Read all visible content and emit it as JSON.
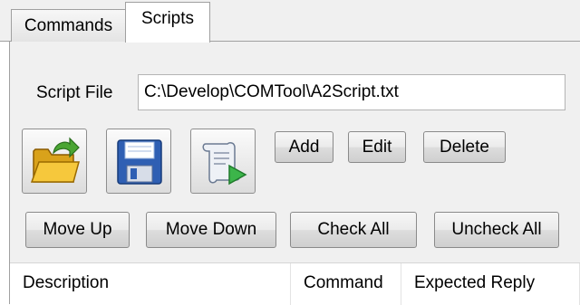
{
  "tabs": [
    {
      "label": "Commands"
    },
    {
      "label": "Scripts"
    }
  ],
  "script_file": {
    "label": "Script File",
    "value": "C:\\Develop\\COMTool\\A2Script.txt"
  },
  "icon_buttons": [
    {
      "icon": "open-folder-icon"
    },
    {
      "icon": "save-floppy-icon"
    },
    {
      "icon": "run-script-icon"
    }
  ],
  "buttons": {
    "add": "Add",
    "edit": "Edit",
    "delete": "Delete",
    "move_up": "Move Up",
    "move_down": "Move Down",
    "check_all": "Check All",
    "uncheck_all": "Uncheck All"
  },
  "list": {
    "columns": [
      "Description",
      "Command",
      "Expected Reply"
    ]
  }
}
